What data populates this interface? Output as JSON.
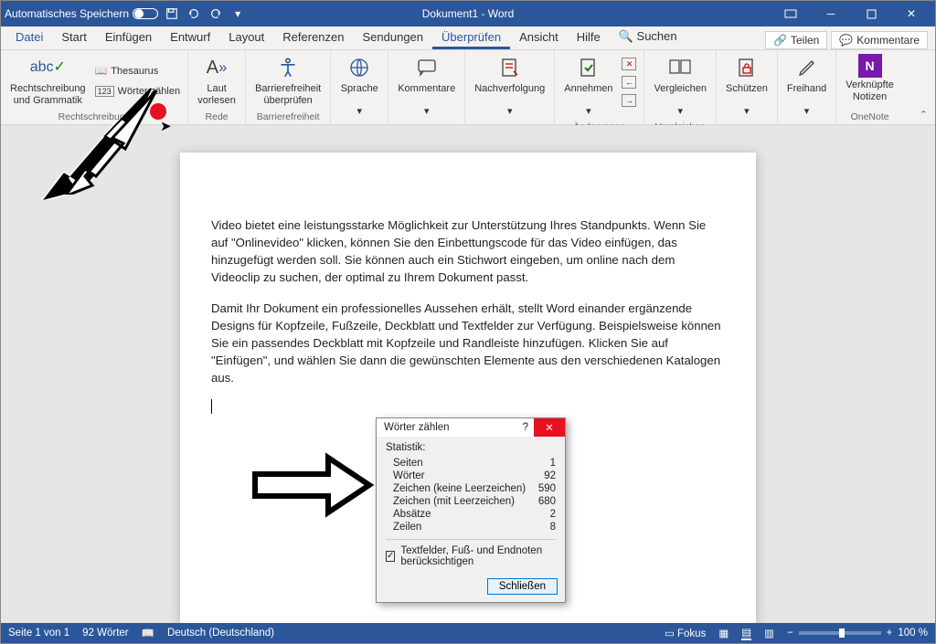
{
  "titlebar": {
    "autosave": "Automatisches Speichern",
    "doc_title": "Dokument1 - Word"
  },
  "tabs": {
    "items": [
      "Datei",
      "Start",
      "Einfügen",
      "Entwurf",
      "Layout",
      "Referenzen",
      "Sendungen",
      "Überprüfen",
      "Ansicht",
      "Hilfe"
    ],
    "search": "Suchen",
    "share": "Teilen",
    "comments": "Kommentare"
  },
  "ribbon": {
    "spelling": "Rechtschreibung\nund Grammatik",
    "thesaurus": "Thesaurus",
    "wordcount": "Wörter zählen",
    "group_spelling": "Rechtschreibung",
    "read_aloud": "Laut\nvorlesen",
    "group_speech": "Rede",
    "accessibility": "Barrierefreiheit\nüberprüfen",
    "group_accessibility": "Barrierefreiheit",
    "language": "Sprache",
    "comments": "Kommentare",
    "tracking": "Nachverfolgung",
    "accept": "Annehmen",
    "group_changes": "Änderungen",
    "compare": "Vergleichen",
    "group_compare": "Vergleichen",
    "protect": "Schützen",
    "ink": "Freihand",
    "linked_notes": "Verknüpfte\nNotizen",
    "group_onenote": "OneNote"
  },
  "document": {
    "p1": "Video bietet eine leistungsstarke Möglichkeit zur Unterstützung Ihres Standpunkts. Wenn Sie auf \"Onlinevideo\" klicken, können Sie den Einbettungscode für das Video einfügen, das hinzugefügt werden soll. Sie können auch ein Stichwort eingeben, um online nach dem Videoclip zu suchen, der optimal zu Ihrem Dokument passt.",
    "p2": "Damit Ihr Dokument ein professionelles Aussehen erhält, stellt Word einander ergänzende Designs für Kopfzeile, Fußzeile, Deckblatt und Textfelder zur Verfügung. Beispielsweise können Sie ein passendes Deckblatt mit Kopfzeile und Randleiste hinzufügen. Klicken Sie auf \"Einfügen\", und wählen Sie dann die gewünschten Elemente aus den verschiedenen Katalogen aus."
  },
  "dialog": {
    "title": "Wörter zählen",
    "stat_header": "Statistik:",
    "rows": [
      {
        "label": "Seiten",
        "value": "1"
      },
      {
        "label": "Wörter",
        "value": "92"
      },
      {
        "label": "Zeichen (keine Leerzeichen)",
        "value": "590"
      },
      {
        "label": "Zeichen (mit Leerzeichen)",
        "value": "680"
      },
      {
        "label": "Absätze",
        "value": "2"
      },
      {
        "label": "Zeilen",
        "value": "8"
      }
    ],
    "checkbox": "Textfelder, Fuß- und Endnoten berücksichtigen",
    "close": "Schließen"
  },
  "statusbar": {
    "page": "Seite 1 von 1",
    "words": "92 Wörter",
    "lang": "Deutsch (Deutschland)",
    "focus": "Fokus",
    "zoom": "100 %"
  }
}
